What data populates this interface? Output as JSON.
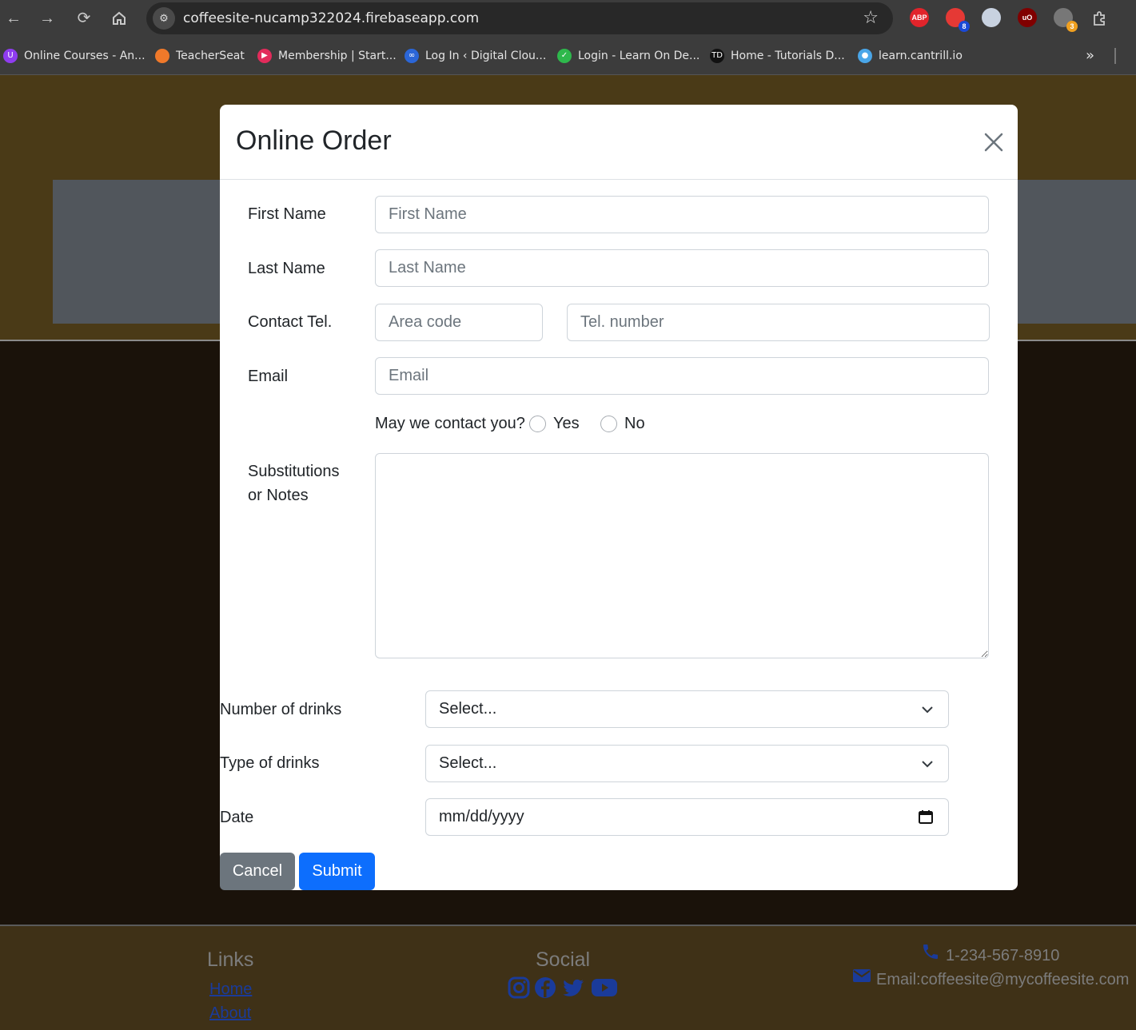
{
  "browser": {
    "url": "coffeesite-nucamp322024.firebaseapp.com",
    "extensions": [
      {
        "label": "ABP",
        "color": "#e1242b",
        "badge": ""
      },
      {
        "label": "",
        "color": "#e53935",
        "badge": "8",
        "badge_color": "#1a49d6"
      },
      {
        "label": "",
        "color": "#c8d2e0",
        "badge": ""
      },
      {
        "label": "uO",
        "color": "#800000",
        "badge": ""
      },
      {
        "label": "",
        "color": "#777777",
        "badge": "3",
        "badge_color": "#f0a020"
      }
    ],
    "bookmarks": [
      {
        "label": "Online Courses - An...",
        "icon_color": "#8f3cf0",
        "icon": "U"
      },
      {
        "label": "TeacherSeat",
        "icon_color": "#f0792a",
        "icon": ""
      },
      {
        "label": "Membership | Start...",
        "icon_color": "#e22b5b",
        "icon": "▶"
      },
      {
        "label": "Log In ‹ Digital Clou...",
        "icon_color": "#2b66d8",
        "icon": "∞"
      },
      {
        "label": "Login - Learn On De...",
        "icon_color": "#2eb84c",
        "icon": "✓"
      },
      {
        "label": "Home - Tutorials D...",
        "icon_color": "#111111",
        "icon": "TD"
      },
      {
        "label": "learn.cantrill.io",
        "icon_color": "#4aa6e8",
        "icon": "●"
      }
    ],
    "overflow_label": "»"
  },
  "modal": {
    "title": "Online Order",
    "fields": {
      "first_name": {
        "label": "First Name",
        "placeholder": "First Name"
      },
      "last_name": {
        "label": "Last Name",
        "placeholder": "Last Name"
      },
      "contact": {
        "label": "Contact Tel.",
        "area_placeholder": "Area code",
        "number_placeholder": "Tel. number"
      },
      "email": {
        "label": "Email",
        "placeholder": "Email"
      },
      "contact_question": {
        "label": "May we contact you?",
        "yes": "Yes",
        "no": "No"
      },
      "notes": {
        "label_line1": "Substitutions",
        "label_line2": "or Notes"
      },
      "num_drinks": {
        "label": "Number of drinks",
        "value": "Select..."
      },
      "type_drinks": {
        "label": "Type of drinks",
        "value": "Select..."
      },
      "date": {
        "label": "Date",
        "value": "mm/dd/yyyy"
      }
    },
    "buttons": {
      "cancel": "Cancel",
      "submit": "Submit"
    }
  },
  "footer": {
    "links_heading": "Links",
    "links": [
      "Home",
      "About"
    ],
    "social_heading": "Social",
    "social_icons": [
      "instagram-icon",
      "facebook-icon",
      "twitter-icon",
      "youtube-icon"
    ],
    "phone": "1-234-567-8910",
    "email": "Email:coffeesite@mycoffeesite.com"
  },
  "colors": {
    "accent": "#0d6efd",
    "secondary": "#6c757d",
    "hero": "#4a3a17",
    "footer": "#3f3117"
  }
}
